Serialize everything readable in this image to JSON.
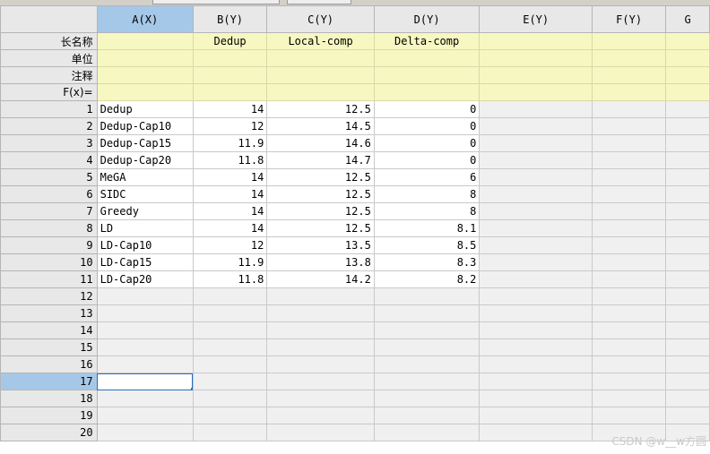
{
  "columns": [
    {
      "label": "A(X)",
      "selected": true
    },
    {
      "label": "B(Y)"
    },
    {
      "label": "C(Y)"
    },
    {
      "label": "D(Y)"
    },
    {
      "label": "E(Y)"
    },
    {
      "label": "F(Y)"
    },
    {
      "label": "G"
    }
  ],
  "meta_rows": [
    {
      "label": "长名称",
      "values": [
        "",
        "Dedup",
        "Local-comp",
        "Delta-comp",
        "",
        "",
        ""
      ]
    },
    {
      "label": "单位",
      "values": [
        "",
        "",
        "",
        "",
        "",
        "",
        ""
      ]
    },
    {
      "label": "注释",
      "values": [
        "",
        "",
        "",
        "",
        "",
        "",
        ""
      ]
    },
    {
      "label": "F(x)=",
      "values": [
        "",
        "",
        "",
        "",
        "",
        "",
        ""
      ]
    }
  ],
  "rows": [
    {
      "n": "1",
      "cells": [
        "Dedup",
        "14",
        "12.5",
        "0"
      ]
    },
    {
      "n": "2",
      "cells": [
        "Dedup-Cap10",
        "12",
        "14.5",
        "0"
      ]
    },
    {
      "n": "3",
      "cells": [
        "Dedup-Cap15",
        "11.9",
        "14.6",
        "0"
      ]
    },
    {
      "n": "4",
      "cells": [
        "Dedup-Cap20",
        "11.8",
        "14.7",
        "0"
      ]
    },
    {
      "n": "5",
      "cells": [
        "MeGA",
        "14",
        "12.5",
        "6"
      ]
    },
    {
      "n": "6",
      "cells": [
        "SIDC",
        "14",
        "12.5",
        "8"
      ]
    },
    {
      "n": "7",
      "cells": [
        "Greedy",
        "14",
        "12.5",
        "8"
      ]
    },
    {
      "n": "8",
      "cells": [
        "LD",
        "14",
        "12.5",
        "8.1"
      ]
    },
    {
      "n": "9",
      "cells": [
        "LD-Cap10",
        "12",
        "13.5",
        "8.5"
      ]
    },
    {
      "n": "10",
      "cells": [
        "LD-Cap15",
        "11.9",
        "13.8",
        "8.3"
      ]
    },
    {
      "n": "11",
      "cells": [
        "LD-Cap20",
        "11.8",
        "14.2",
        "8.2"
      ]
    }
  ],
  "empty_rows": [
    "12",
    "13",
    "14",
    "15",
    "16",
    "17",
    "18",
    "19",
    "20"
  ],
  "selected_row": "17",
  "watermark": "CSDN @w__w方圆"
}
